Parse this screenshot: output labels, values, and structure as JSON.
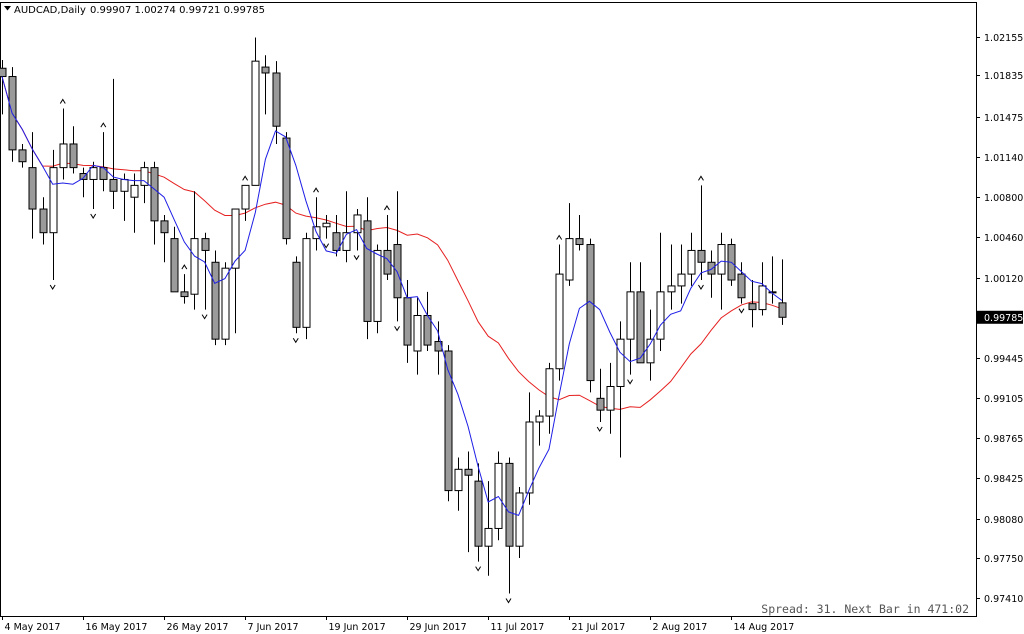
{
  "chart_data": {
    "type": "candlestick",
    "symbol": "AUDCAD,Daily",
    "ohlc_text": "0.99907 1.00274 0.99721 0.99785",
    "y_ticks": [
      "1.02155",
      "1.01835",
      "1.01475",
      "1.01140",
      "1.00800",
      "1.00460",
      "1.00120",
      "0.99445",
      "0.99105",
      "0.98765",
      "0.98425",
      "0.98080",
      "0.97750",
      "0.97410"
    ],
    "current_price": "0.99785",
    "x_labels": [
      "4 May 2017",
      "16 May 2017",
      "26 May 2017",
      "7 Jun 2017",
      "19 Jun 2017",
      "29 Jun 2017",
      "11 Jul 2017",
      "21 Jul 2017",
      "2 Aug 2017",
      "14 Aug 2017"
    ],
    "ylim": [
      0.9726,
      1.0245
    ],
    "candles": [
      [
        1.0189,
        1.0196,
        1.015,
        1.0182
      ],
      [
        1.0182,
        1.019,
        1.011,
        1.012
      ],
      [
        1.012,
        1.0125,
        1.0105,
        1.011
      ],
      [
        1.0105,
        1.0135,
        1.0045,
        1.007
      ],
      [
        1.007,
        1.008,
        1.004,
        1.005
      ],
      [
        1.005,
        1.012,
        1.001,
        1.0105
      ],
      [
        1.0105,
        1.0155,
        1.0095,
        1.0125
      ],
      [
        1.0125,
        1.014,
        1.01,
        1.0105
      ],
      [
        1.01,
        1.0105,
        1.008,
        1.0095
      ],
      [
        1.0095,
        1.011,
        1.007,
        1.0105
      ],
      [
        1.0105,
        1.0135,
        1.0085,
        1.0095
      ],
      [
        1.0095,
        1.018,
        1.007,
        1.0085
      ],
      [
        1.0085,
        1.01,
        1.006,
        1.0095
      ],
      [
        1.008,
        1.01,
        1.005,
        1.009
      ],
      [
        1.009,
        1.011,
        1.0075,
        1.0105
      ],
      [
        1.0105,
        1.011,
        1.004,
        1.006
      ],
      [
        1.006,
        1.0065,
        1.0025,
        1.005
      ],
      [
        1.0045,
        1.0055,
        1.0,
        1.0
      ],
      [
        1.0,
        1.0015,
        0.999,
        0.9996
      ],
      [
        0.9998,
        1.0085,
        0.9985,
        1.0045
      ],
      [
        1.0045,
        1.005,
        0.9985,
        1.0035
      ],
      [
        1.0025,
        1.0035,
        0.9955,
        0.996
      ],
      [
        0.996,
        1.0025,
        0.9955,
        1.002
      ],
      [
        1.002,
        1.006,
        0.9965,
        1.007
      ],
      [
        1.007,
        1.009,
        1.006,
        1.009
      ],
      [
        1.009,
        1.0215,
        1.009,
        1.0195
      ],
      [
        1.019,
        1.02,
        1.015,
        1.0185
      ],
      [
        1.0185,
        1.0195,
        1.0125,
        1.014
      ],
      [
        1.013,
        1.0135,
        1.004,
        1.0045
      ],
      [
        1.0025,
        1.003,
        0.9965,
        0.997
      ],
      [
        0.997,
        1.005,
        0.996,
        1.0045
      ],
      [
        1.0045,
        1.008,
        1.0035,
        1.0055
      ],
      [
        1.0055,
        1.0065,
        1.0045,
        1.0058
      ],
      [
        1.005,
        1.0065,
        1.003,
        1.0035
      ],
      [
        1.0035,
        1.0085,
        1.0025,
        1.005
      ],
      [
        1.005,
        1.007,
        1.0035,
        1.0065
      ],
      [
        1.006,
        1.008,
        0.996,
        0.9975
      ],
      [
        0.9975,
        1.004,
        0.9965,
        1.0035
      ],
      [
        1.0035,
        1.0065,
        1.001,
        1.0015
      ],
      [
        1.004,
        1.0085,
        0.9975,
        0.9995
      ],
      [
        0.9995,
        1.001,
        0.994,
        0.9955
      ],
      [
        0.995,
        0.9995,
        0.993,
        0.998
      ],
      [
        0.998,
        1.0,
        0.995,
        0.9955
      ],
      [
        0.9958,
        0.9975,
        0.993,
        0.995
      ],
      [
        0.995,
        0.9955,
        0.9823,
        0.9832
      ],
      [
        0.9832,
        0.986,
        0.9815,
        0.985
      ],
      [
        0.985,
        0.9865,
        0.978,
        0.9845
      ],
      [
        0.984,
        0.9855,
        0.9772,
        0.9785
      ],
      [
        0.9785,
        0.984,
        0.976,
        0.98
      ],
      [
        0.98,
        0.9865,
        0.979,
        0.9855
      ],
      [
        0.9855,
        0.986,
        0.9745,
        0.9785
      ],
      [
        0.9785,
        0.9835,
        0.9775,
        0.983
      ],
      [
        0.983,
        0.9915,
        0.982,
        0.989
      ],
      [
        0.989,
        0.99,
        0.987,
        0.9895
      ],
      [
        0.9895,
        0.994,
        0.988,
        0.9935
      ],
      [
        0.9935,
        1.004,
        0.9925,
        1.0015
      ],
      [
        1.001,
        1.0075,
        1.0005,
        1.0045
      ],
      [
        1.0045,
        1.0065,
        1.0035,
        1.004
      ],
      [
        1.004,
        1.0045,
        0.9915,
        0.9925
      ],
      [
        0.991,
        0.9935,
        0.989,
        0.99
      ],
      [
        0.99,
        0.994,
        0.988,
        0.992
      ],
      [
        0.992,
        0.9975,
        0.986,
        0.996
      ],
      [
        0.996,
        1.0025,
        0.993,
        1.0
      ],
      [
        1.0,
        1.0025,
        0.996,
        0.994
      ],
      [
        0.994,
        0.9985,
        0.9925,
        0.996
      ],
      [
        0.996,
        1.005,
        0.995,
        1.0
      ],
      [
        1.0,
        1.004,
        0.9985,
        1.0005
      ],
      [
        1.0005,
        1.004,
        0.999,
        1.0015
      ],
      [
        1.0015,
        1.005,
        1.0005,
        1.0035
      ],
      [
        1.0035,
        1.009,
        1.001,
        1.0025
      ],
      [
        1.0025,
        1.0035,
        0.9995,
        1.0015
      ],
      [
        1.0015,
        1.005,
        0.9985,
        1.004
      ],
      [
        1.004,
        1.0045,
        1.0005,
        1.001
      ],
      [
        1.0015,
        1.0025,
        0.999,
        0.9995
      ],
      [
        0.999,
        1.001,
        0.997,
        0.9985
      ],
      [
        0.9985,
        1.0025,
        0.998,
        1.0005
      ],
      [
        1.0,
        1.003,
        0.999,
        1.0
      ],
      [
        0.99907,
        1.00274,
        0.99721,
        0.99785
      ]
    ],
    "fractals_up": [
      6,
      10,
      18,
      24,
      31,
      38,
      55,
      69
    ],
    "fractals_down": [
      5,
      9,
      20,
      29,
      32,
      35,
      39,
      47,
      50,
      59,
      62,
      69,
      73
    ],
    "ma_fast_period": 5,
    "ma_slow_period": 20,
    "colors": {
      "ma_fast": "#1e1ee6",
      "ma_slow": "#e62020",
      "bear_fill": "#9a9a9a",
      "bull_fill": "#ffffff",
      "outline": "#000000",
      "price_label_bg": "#000000",
      "price_label_text": "#ffffff"
    }
  },
  "status": {
    "spread_text": "Spread: 31. Next Bar in 471:02"
  }
}
